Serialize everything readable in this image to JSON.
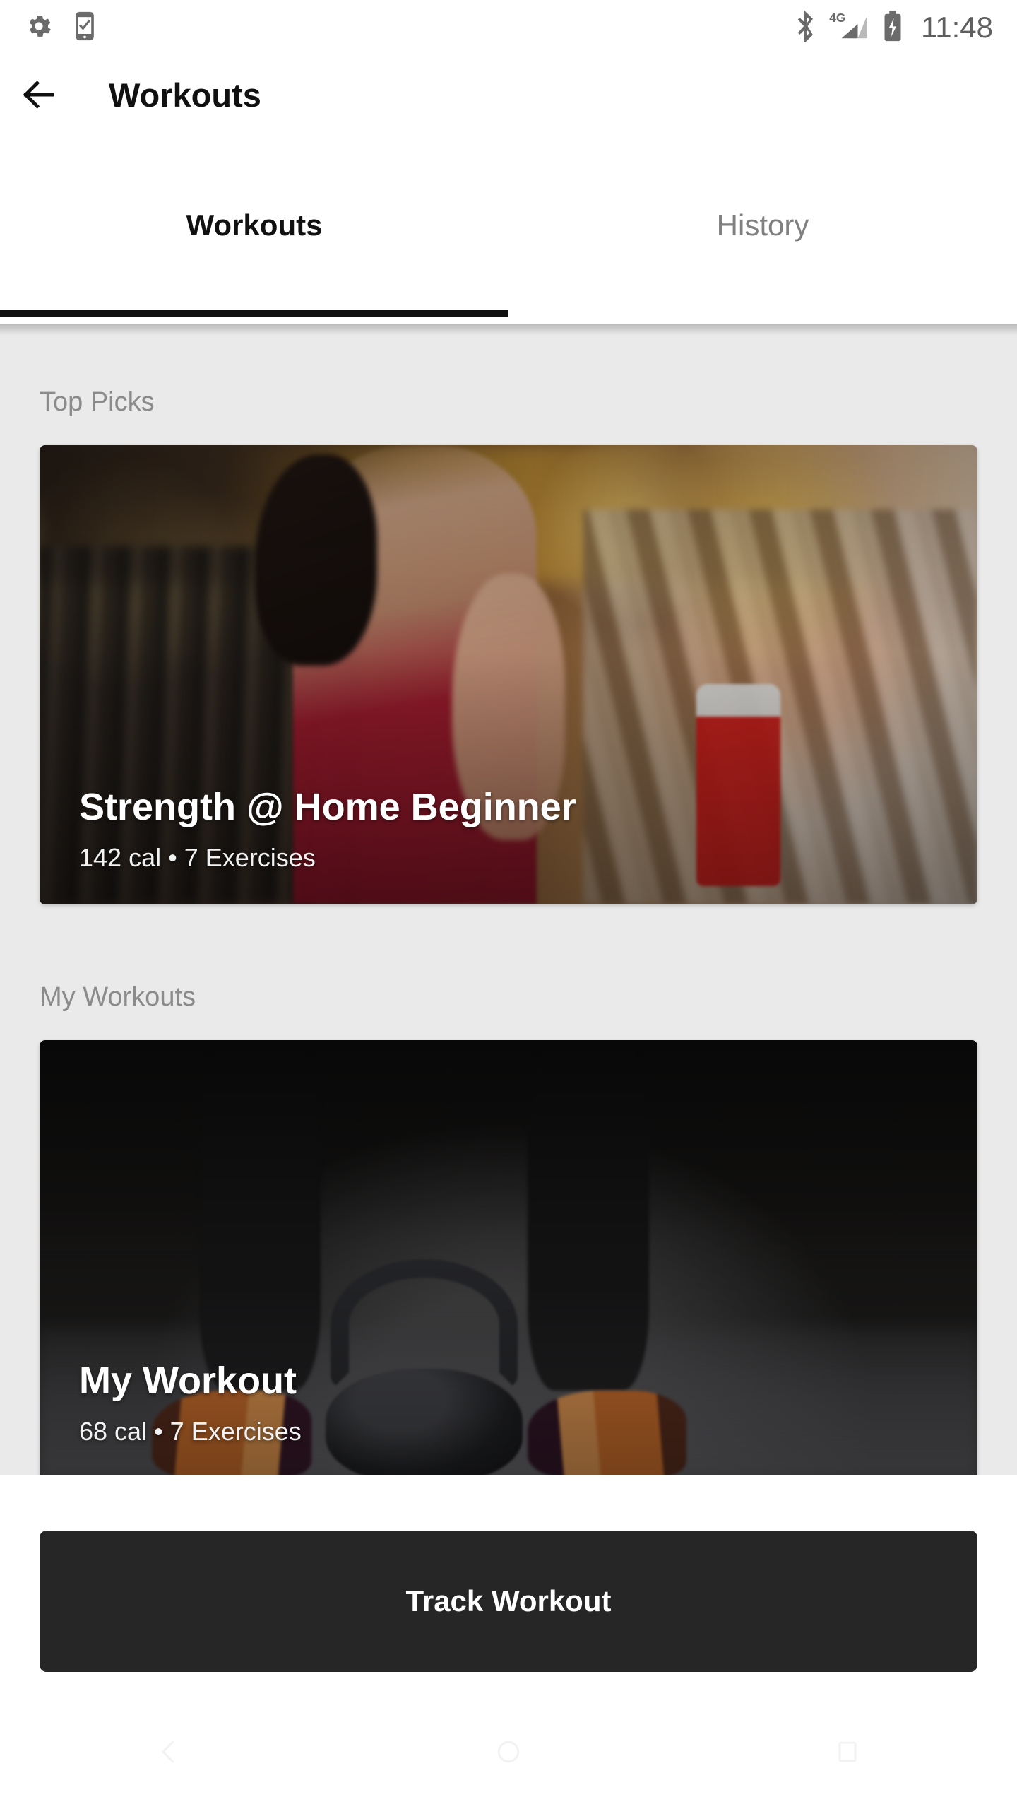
{
  "statusbar": {
    "time": "11:48",
    "left_icons": [
      {
        "name": "settings-gear-icon"
      },
      {
        "name": "phone-check-icon"
      }
    ],
    "right_icons": [
      {
        "name": "bluetooth-icon"
      },
      {
        "name": "signal-4g-icon",
        "label": "4G"
      },
      {
        "name": "battery-charging-icon"
      }
    ]
  },
  "appbar": {
    "back_label": "Back",
    "title": "Workouts"
  },
  "tabs": [
    {
      "label": "Workouts",
      "active": true
    },
    {
      "label": "History",
      "active": false
    }
  ],
  "sections": [
    {
      "title": "Top Picks",
      "card": {
        "title": "Strength @ Home Beginner",
        "subtitle": "142 cal • 7 Exercises",
        "calories": "142 cal",
        "exercises": "7 Exercises",
        "image_alt": "woman-running-treadmill-gym"
      }
    },
    {
      "title": "My Workouts",
      "card": {
        "title": "My Workout",
        "subtitle": "68 cal • 7 Exercises",
        "calories": "68 cal",
        "exercises": "7 Exercises",
        "image_alt": "kettlebell-between-legs-gym-floor"
      }
    }
  ],
  "bottom": {
    "track_label": "Track Workout"
  },
  "navbar": {
    "back": "back-triangle-icon",
    "home": "home-circle-icon",
    "recents": "recents-square-icon"
  },
  "colors": {
    "accent": "#262626",
    "content_bg": "#eaeaea",
    "surface": "#ffffff",
    "text_primary": "#111111",
    "text_muted": "#8b8b8b",
    "tab_inactive": "#808080"
  }
}
